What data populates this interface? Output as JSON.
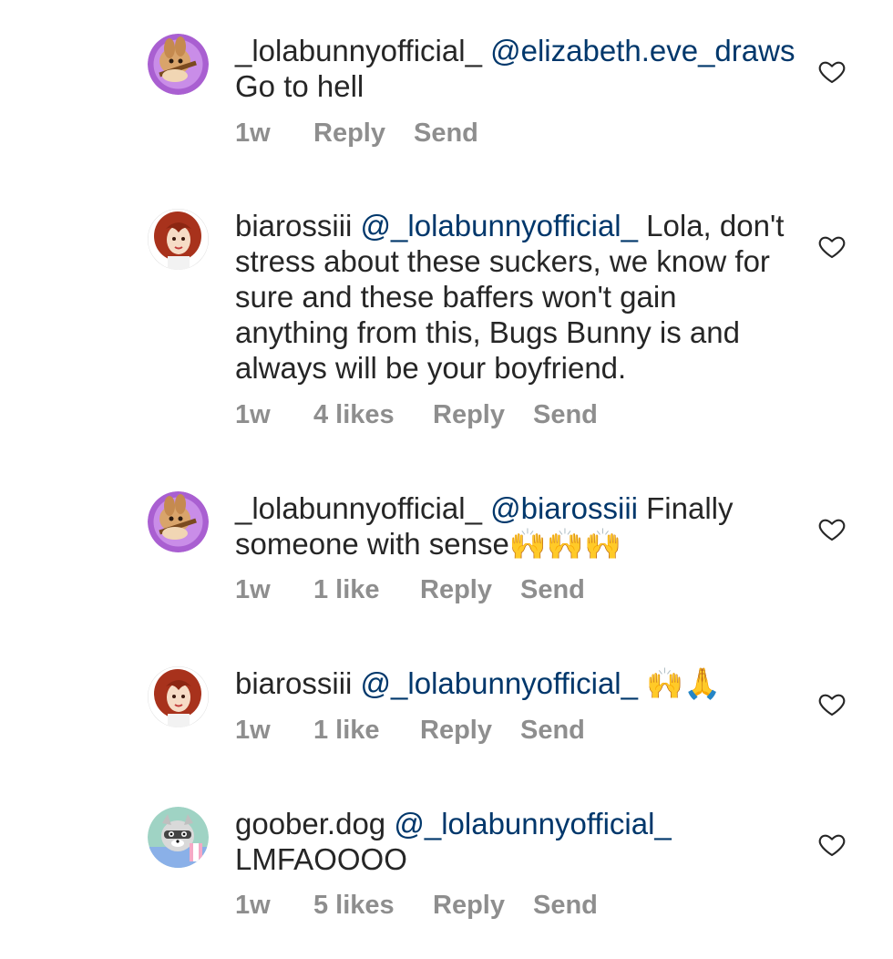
{
  "comments": [
    {
      "username": "_lolabunnyofficial_",
      "mention": "@elizabeth.eve_draws",
      "text": " Go to hell",
      "time": "1w",
      "likes": "",
      "reply_label": "Reply",
      "send_label": "Send",
      "avatar": "lola-bunny-avatar"
    },
    {
      "username": "biarossiii",
      "mention": "@_lolabunnyofficial_",
      "text": " Lola, don't stress about these suckers, we know for sure and these baffers won't gain anything from this, Bugs Bunny is and always will be your boyfriend.",
      "time": "1w",
      "likes": "4 likes",
      "reply_label": "Reply",
      "send_label": "Send",
      "avatar": "redhead-avatar"
    },
    {
      "username": "_lolabunnyofficial_",
      "mention": "@biarossiii",
      "text": " Finally someone with sense🙌🙌🙌",
      "time": "1w",
      "likes": "1 like",
      "reply_label": "Reply",
      "send_label": "Send",
      "avatar": "lola-bunny-avatar"
    },
    {
      "username": "biarossiii",
      "mention": "@_lolabunnyofficial_",
      "text": " 🙌🙏",
      "time": "1w",
      "likes": "1 like",
      "reply_label": "Reply",
      "send_label": "Send",
      "avatar": "redhead-avatar"
    },
    {
      "username": "goober.dog",
      "mention": "@_lolabunnyofficial_",
      "text": " LMFAOOOO",
      "time": "1w",
      "likes": "5 likes",
      "reply_label": "Reply",
      "send_label": "Send",
      "avatar": "raccoon-avatar"
    }
  ],
  "colors": {
    "text": "#262626",
    "mention": "#00376b",
    "meta": "#8e8e8e"
  }
}
